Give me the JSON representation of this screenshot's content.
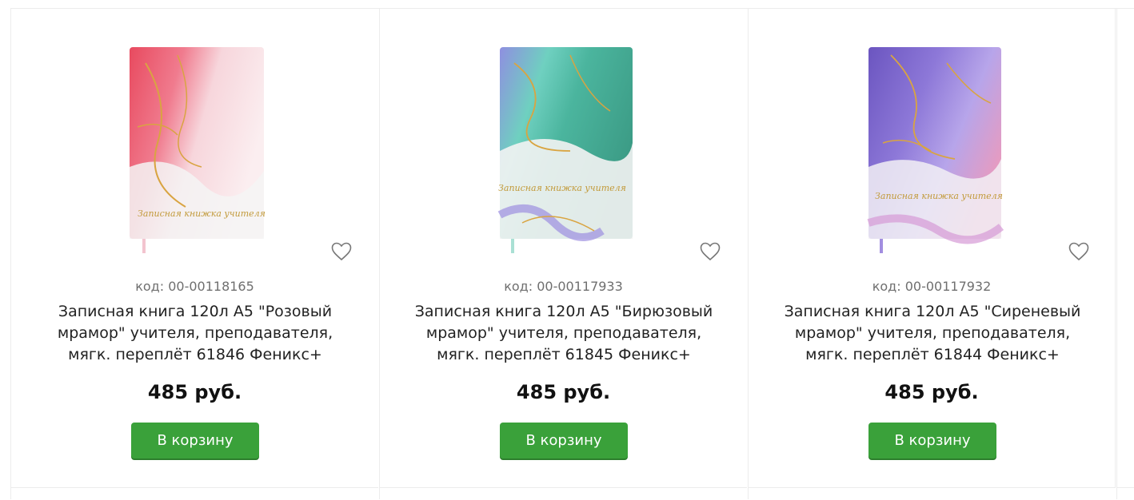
{
  "products": [
    {
      "code": "код: 00-00118165",
      "title": "Записная книга 120л А5 \"Розовый мрамор\" учителя, преподавателя, мягк. переплёт 61846 Феникс+",
      "price": "485 руб.",
      "button_label": "В корзину",
      "cover_text": "Записная книжка учителя",
      "colors": [
        "#e84a5f",
        "#f5a3b3",
        "#f7e0e4",
        "#d9a441"
      ]
    },
    {
      "code": "код: 00-00117933",
      "title": "Записная книга 120л А5 \"Бирюзовый мрамор\" учителя, преподавателя, мягк. переплёт 61845 Феникс+",
      "price": "485 руб.",
      "button_label": "В корзину",
      "cover_text": "Записная книжка учителя",
      "colors": [
        "#5bc5b0",
        "#8f8fe0",
        "#e7f3f0",
        "#d9a441"
      ]
    },
    {
      "code": "код: 00-00117932",
      "title": "Записная книга 120л А5 \"Сиреневый мрамор\" учителя, преподавателя, мягк. переплёт 61844 Феникс+",
      "price": "485 руб.",
      "button_label": "В корзину",
      "cover_text": "Записная книжка учителя",
      "colors": [
        "#7a62c9",
        "#b39ae8",
        "#efe9f7",
        "#d9a441"
      ]
    }
  ],
  "accent_color": "#3aa13a"
}
